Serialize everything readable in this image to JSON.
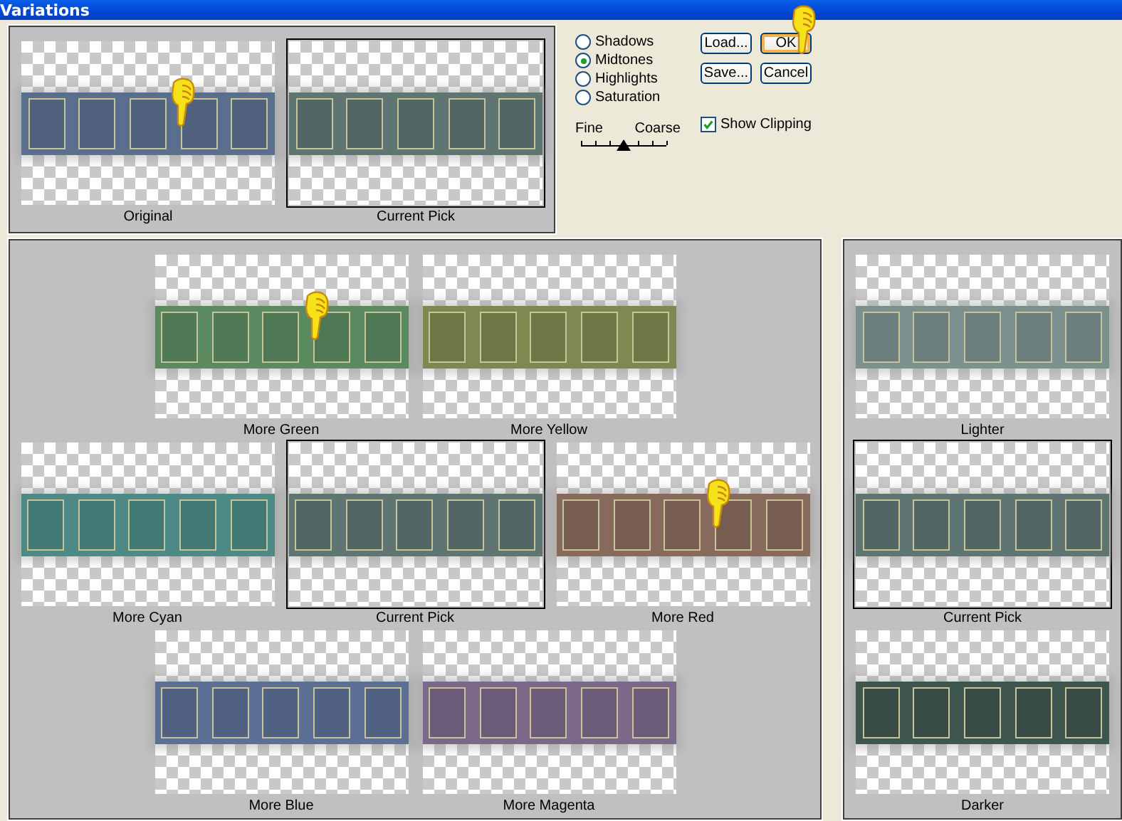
{
  "window": {
    "title": "Variations"
  },
  "preview": [
    {
      "label": "Original",
      "color": "#5a6f8e",
      "selected": false,
      "pointer": true
    },
    {
      "label": "Current Pick",
      "color": "#5e7571",
      "selected": true,
      "pointer": false
    }
  ],
  "range": [
    {
      "label": "Shadows",
      "selected": false
    },
    {
      "label": "Midtones",
      "selected": true
    },
    {
      "label": "Highlights",
      "selected": false
    },
    {
      "label": "Saturation",
      "selected": false
    }
  ],
  "scale": {
    "left_label": "Fine",
    "right_label": "Coarse",
    "level": 0.5
  },
  "buttons": [
    {
      "label": "Load...",
      "focused": false,
      "pointer": false
    },
    {
      "label": "OK",
      "focused": true,
      "pointer": true
    },
    {
      "label": "Save...",
      "focused": false,
      "pointer": false
    },
    {
      "label": "Cancel",
      "focused": false,
      "pointer": false
    }
  ],
  "show_clipping": {
    "label": "Show Clipping",
    "checked": true
  },
  "color_variations": [
    [
      {
        "label": "More Green",
        "color": "#5b8a60",
        "selected": false,
        "pointer": true
      },
      {
        "label": "More Yellow",
        "color": "#7f8850",
        "selected": false,
        "pointer": false
      }
    ],
    [
      {
        "label": "More Cyan",
        "color": "#4d8a85",
        "selected": false,
        "pointer": false
      },
      {
        "label": "Current Pick",
        "color": "#5e7571",
        "selected": true,
        "pointer": false
      },
      {
        "label": "More Red",
        "color": "#876a5c",
        "selected": false,
        "pointer": true
      }
    ],
    [
      {
        "label": "More Blue",
        "color": "#5d6f95",
        "selected": false,
        "pointer": false
      },
      {
        "label": "More Magenta",
        "color": "#7c6889",
        "selected": false,
        "pointer": false
      }
    ]
  ],
  "brightness_variations": [
    {
      "label": "Lighter",
      "color": "#7c9090",
      "selected": false,
      "pointer": false
    },
    {
      "label": "Current Pick",
      "color": "#5e7571",
      "selected": true,
      "pointer": false
    },
    {
      "label": "Darker",
      "color": "#3f554f",
      "selected": false,
      "pointer": false
    }
  ]
}
